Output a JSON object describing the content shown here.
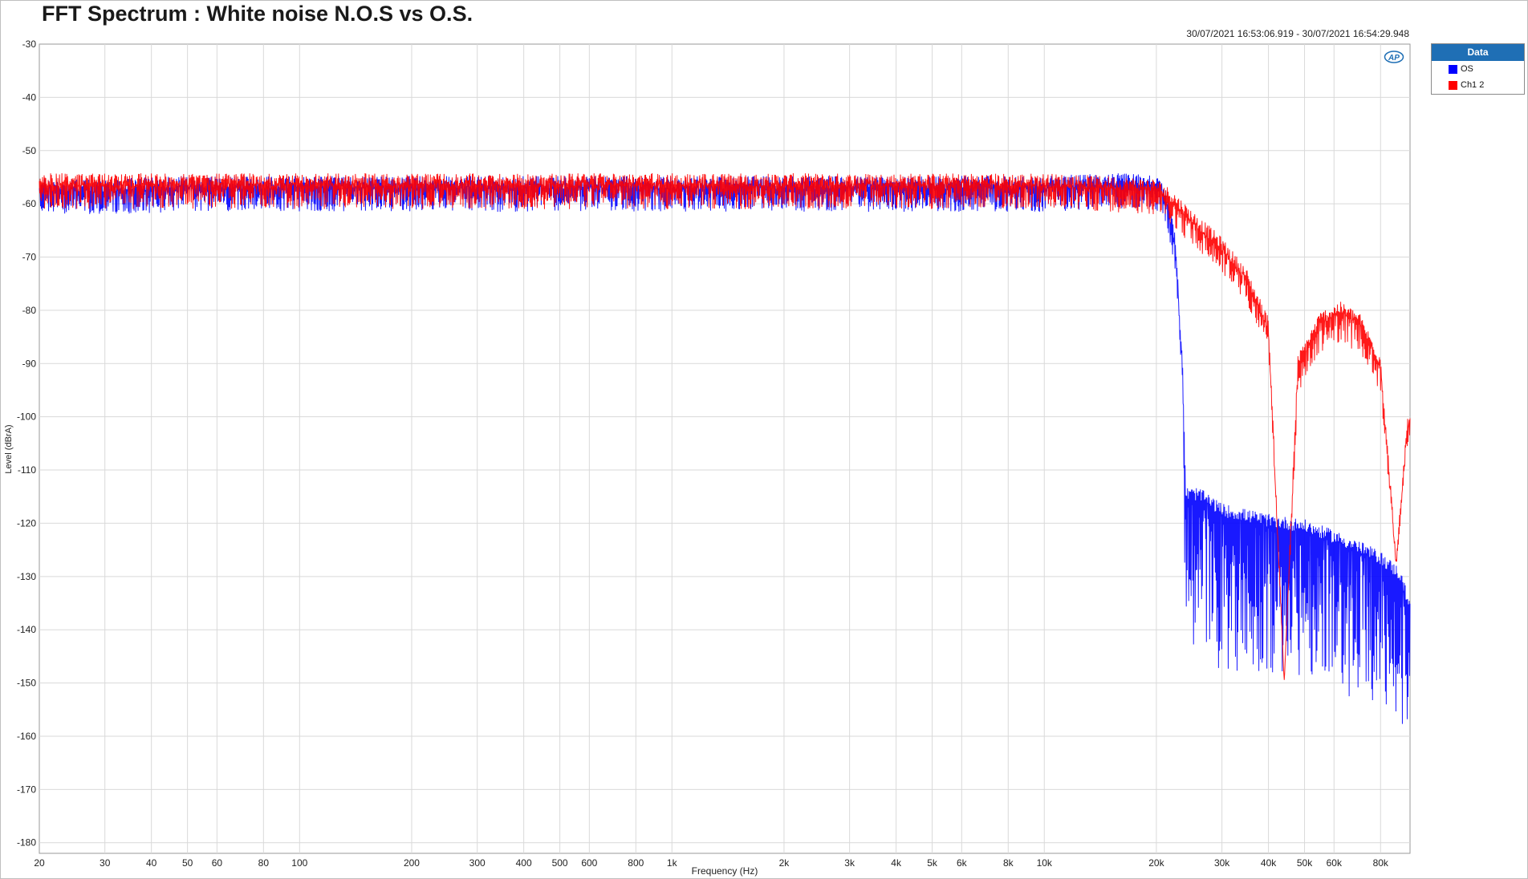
{
  "title": "FFT Spectrum : White noise N.O.S  vs O.S.",
  "timestamp": "30/07/2021 16:53:06.919 - 30/07/2021 16:54:29.948",
  "logo_text": "AP",
  "legend": {
    "header": "Data",
    "items": [
      {
        "label": "OS",
        "color": "#0000ff"
      },
      {
        "label": "Ch1  2",
        "color": "#ff0000"
      }
    ]
  },
  "chart_data": {
    "type": "line",
    "xlabel": "Frequency (Hz)",
    "ylabel": "Level (dBrA)",
    "xscale": "log",
    "xlim": [
      20,
      96000
    ],
    "ylim": [
      -182,
      -30
    ],
    "grid": true,
    "legend_position": "right",
    "x_ticks": [
      {
        "value": 20,
        "label": "20"
      },
      {
        "value": 30,
        "label": "30"
      },
      {
        "value": 40,
        "label": "40"
      },
      {
        "value": 50,
        "label": "50"
      },
      {
        "value": 60,
        "label": "60"
      },
      {
        "value": 80,
        "label": "80"
      },
      {
        "value": 100,
        "label": "100"
      },
      {
        "value": 200,
        "label": "200"
      },
      {
        "value": 300,
        "label": "300"
      },
      {
        "value": 400,
        "label": "400"
      },
      {
        "value": 500,
        "label": "500"
      },
      {
        "value": 600,
        "label": "600"
      },
      {
        "value": 800,
        "label": "800"
      },
      {
        "value": 1000,
        "label": "1k"
      },
      {
        "value": 2000,
        "label": "2k"
      },
      {
        "value": 3000,
        "label": "3k"
      },
      {
        "value": 4000,
        "label": "4k"
      },
      {
        "value": 5000,
        "label": "5k"
      },
      {
        "value": 6000,
        "label": "6k"
      },
      {
        "value": 8000,
        "label": "8k"
      },
      {
        "value": 10000,
        "label": "10k"
      },
      {
        "value": 20000,
        "label": "20k"
      },
      {
        "value": 30000,
        "label": "30k"
      },
      {
        "value": 40000,
        "label": "40k"
      },
      {
        "value": 50000,
        "label": "50k"
      },
      {
        "value": 60000,
        "label": "60k"
      },
      {
        "value": 80000,
        "label": "80k"
      }
    ],
    "y_ticks": [
      -30,
      -40,
      -50,
      -60,
      -70,
      -80,
      -90,
      -100,
      -110,
      -120,
      -130,
      -140,
      -150,
      -160,
      -170,
      -180
    ],
    "series": [
      {
        "name": "OS",
        "color": "#0000ff",
        "x": [
          20,
          30,
          50,
          100,
          200,
          500,
          1000,
          2000,
          5000,
          10000,
          15000,
          19000,
          20500,
          21500,
          22500,
          23500,
          24000,
          26000,
          30000,
          40000,
          50000,
          60000,
          70000,
          80000,
          90000,
          96000
        ],
        "y": [
          -57,
          -57,
          -56.5,
          -56.5,
          -56.5,
          -56.5,
          -56.5,
          -56.5,
          -56.5,
          -56.5,
          -56,
          -56,
          -57,
          -60,
          -68,
          -90,
          -115,
          -115,
          -118,
          -120,
          -121,
          -123,
          -125,
          -127,
          -130,
          -136
        ],
        "spread_low": [
          -5,
          -5,
          -5,
          -5,
          -5,
          -5,
          -5,
          -5,
          -5,
          -5,
          -5,
          -5,
          -5,
          -5,
          -5,
          -5,
          -32,
          -30,
          -30,
          -29,
          -28,
          -28,
          -29,
          -29,
          -29,
          -22
        ]
      },
      {
        "name": "Ch1  2",
        "color": "#ff0000",
        "x": [
          20,
          30,
          50,
          100,
          200,
          500,
          1000,
          2000,
          5000,
          10000,
          15000,
          20000,
          22000,
          25000,
          30000,
          35000,
          40000,
          44100,
          48000,
          55000,
          62000,
          70000,
          80000,
          88200,
          94000,
          96000
        ],
        "y": [
          -56,
          -56,
          -56,
          -56,
          -56,
          -56,
          -56,
          -56,
          -56,
          -56,
          -56.5,
          -57,
          -59,
          -63,
          -68,
          -74,
          -83,
          -150,
          -90,
          -82,
          -80,
          -82,
          -90,
          -128,
          -103,
          -100
        ],
        "spread_low": [
          -5,
          -5,
          -5,
          -5,
          -5,
          -5,
          -5,
          -5,
          -5,
          -5,
          -5,
          -5,
          -5,
          -5,
          -5,
          -5,
          -4,
          0,
          -6,
          -6,
          -6,
          -6,
          -6,
          0,
          -6,
          -5
        ]
      }
    ]
  }
}
